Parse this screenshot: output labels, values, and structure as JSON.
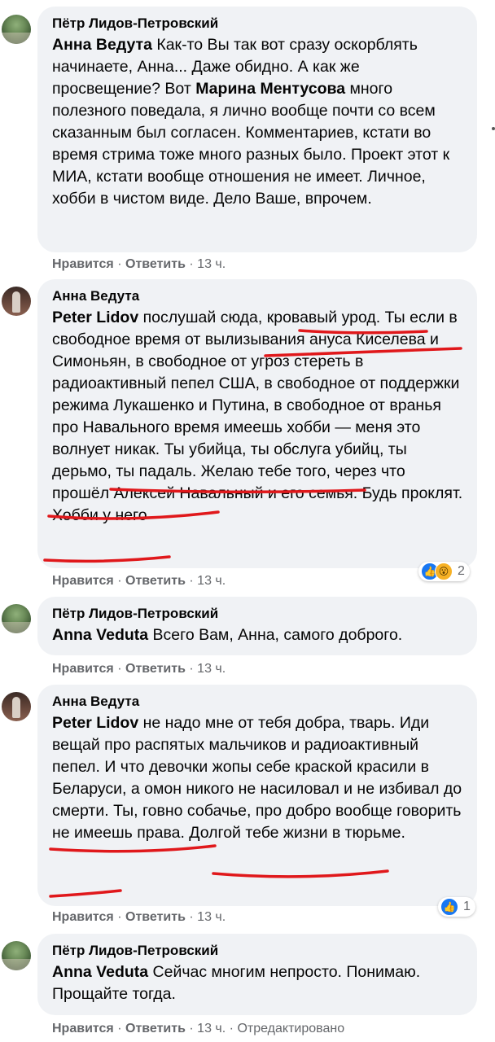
{
  "comments": [
    {
      "author": "Пётр Лидов-Петровский",
      "mention": "Анна Ведута",
      "text_before_mention2": " Как-то Вы так вот сразу оскорблять начинаете, Анна... Даже обидно. А как же просвещение? Вот ",
      "mention2": "Марина Ментусова",
      "text_after": " много полезного поведала, я лично вообще почти со всем сказанным был согласен. Комментариев, кстати во время стрима тоже много разных было. Проект этот к МИА, кстати вообще отношения не имеет. Личное, хобби в чистом виде. Дело Ваше, впрочем.",
      "like_label": "Нравится",
      "reply_label": "Ответить",
      "time": "13 ч."
    },
    {
      "author": "Анна Ведута",
      "mention": "Peter Lidov",
      "text": " послушай сюда, кровавый урод. Ты если в свободное время от вылизывания ануса Киселева и Симоньян, в свободное от угроз стереть в радиоактивный пепел США, в свободное от поддержки режима Лукашенко и Путина, в свободное от вранья про Навального время имеешь хобби — меня это волнует никак. Ты убийца, ты обслуга убийц, ты дерьмо, ты падаль. Желаю тебе того, через что прошёл Алексей Навальный и его семья. Будь проклят. Хобби у него",
      "like_label": "Нравится",
      "reply_label": "Ответить",
      "time": "13 ч.",
      "reaction_count": "2"
    },
    {
      "author": "Пётр Лидов-Петровский",
      "mention": "Anna Veduta",
      "text": " Всего Вам, Анна, самого доброго.",
      "like_label": "Нравится",
      "reply_label": "Ответить",
      "time": "13 ч."
    },
    {
      "author": "Анна Ведута",
      "mention": "Peter Lidov",
      "text": " не надо мне от тебя добра, тварь. Иди вещай про распятых мальчиков и радиоактивный пепел. И что девочки жопы себе краской красили в Беларуси, а омон никого не насиловал и не избивал до смерти. Ты, говно собачье, про добро вообще говорить не имеешь права. Долгой тебе жизни в тюрьме.",
      "like_label": "Нравится",
      "reply_label": "Ответить",
      "time": "13 ч.",
      "reaction_count": "1"
    },
    {
      "author": "Пётр Лидов-Петровский",
      "mention": "Anna Veduta",
      "text": " Сейчас многим непросто. Понимаю. Прощайте тогда.",
      "like_label": "Нравится",
      "reply_label": "Ответить",
      "time": "13 ч.",
      "edited": "Отредактировано"
    }
  ],
  "icons": {
    "like": "👍",
    "wow": "😮",
    "separator": "·"
  },
  "colors": {
    "bubble": "#f0f2f5",
    "meta": "#65676b",
    "like_blue": "#1877f2",
    "underline_red": "#e0181b"
  }
}
